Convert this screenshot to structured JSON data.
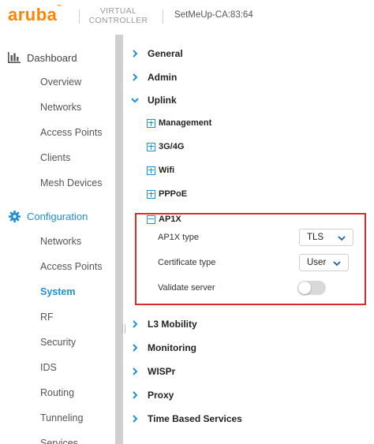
{
  "header": {
    "logo": "aruba",
    "product_line1": "VIRTUAL",
    "product_line2": "CONTROLLER",
    "device_name": "SetMeUp-CA:83:64"
  },
  "sidebar": {
    "dashboard": {
      "label": "Dashboard",
      "icon": "bar-chart-icon",
      "items": [
        "Overview",
        "Networks",
        "Access Points",
        "Clients",
        "Mesh Devices"
      ]
    },
    "configuration": {
      "label": "Configuration",
      "icon": "gear-icon",
      "items": [
        "Networks",
        "Access Points",
        "System",
        "RF",
        "Security",
        "IDS",
        "Routing",
        "Tunneling",
        "Services"
      ],
      "active": "System"
    }
  },
  "main": {
    "sections_top": [
      "General",
      "Admin"
    ],
    "uplink": {
      "label": "Uplink",
      "subsections": [
        "Management",
        "3G/4G",
        "Wifi",
        "PPPoE"
      ],
      "ap1x": {
        "label": "AP1X",
        "ap1x_type_label": "AP1X type",
        "ap1x_type_value": "TLS",
        "cert_type_label": "Certificate type",
        "cert_type_value": "User",
        "validate_label": "Validate server",
        "validate_enabled": false
      }
    },
    "sections_bottom": [
      "L3 Mobility",
      "Monitoring",
      "WISPr",
      "Proxy",
      "Time Based Services"
    ]
  },
  "colors": {
    "brand": "#ff8300",
    "accent": "#1f8fd6",
    "highlight_box": "#e02b2b"
  }
}
